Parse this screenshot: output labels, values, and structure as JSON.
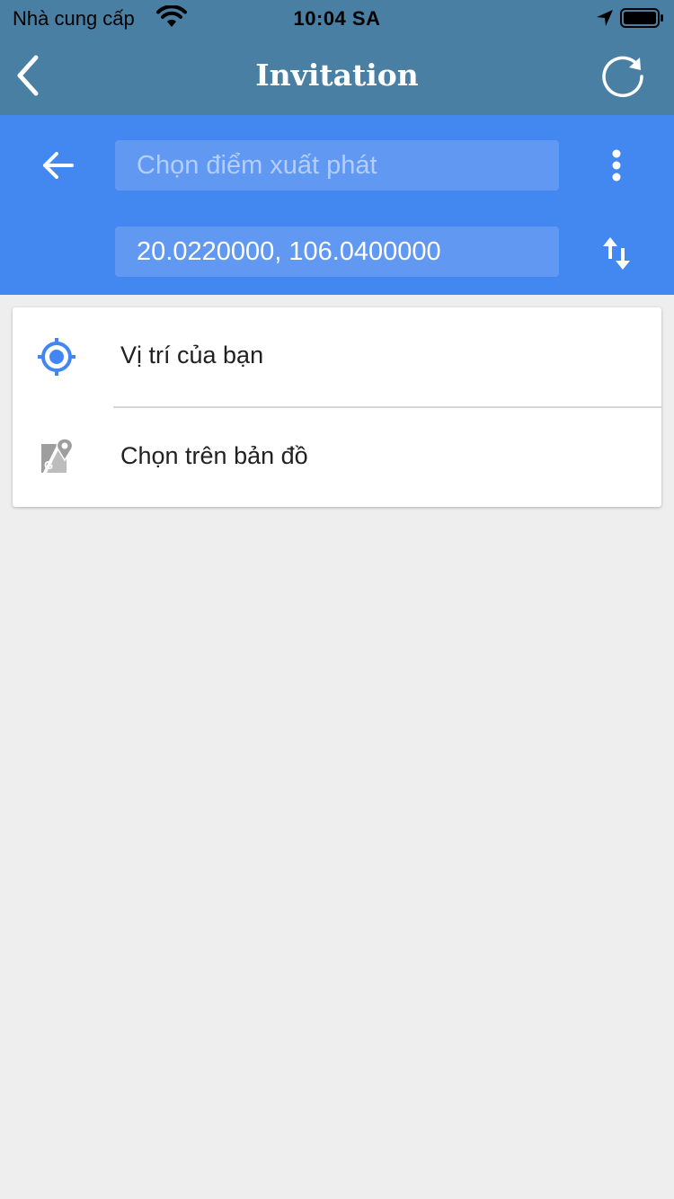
{
  "status_bar": {
    "carrier": "Nhà cung cấp",
    "time": "10:04 SA",
    "icons": [
      "wifi-icon",
      "location-arrow-icon",
      "battery-icon"
    ]
  },
  "nav": {
    "title": "Invitation",
    "back_icon": "chevron-left-icon",
    "refresh_icon": "refresh-icon"
  },
  "directions": {
    "start_placeholder": "Chọn điểm xuất phát",
    "destination_value": "20.0220000, 106.0400000",
    "back_icon": "arrow-left-icon",
    "menu_icon": "more-vert-icon",
    "swap_icon": "swap-vert-icon"
  },
  "suggestions": [
    {
      "label": "Vị trí của bạn",
      "icon": "my-location-icon"
    },
    {
      "label": "Chọn trên bản đồ",
      "icon": "google-maps-pin-icon"
    }
  ],
  "colors": {
    "nav_bar": "#4a7fa4",
    "panel": "#4387f0",
    "field": "#6098f2",
    "accent": "#4285f4",
    "background": "#eeeeee"
  }
}
